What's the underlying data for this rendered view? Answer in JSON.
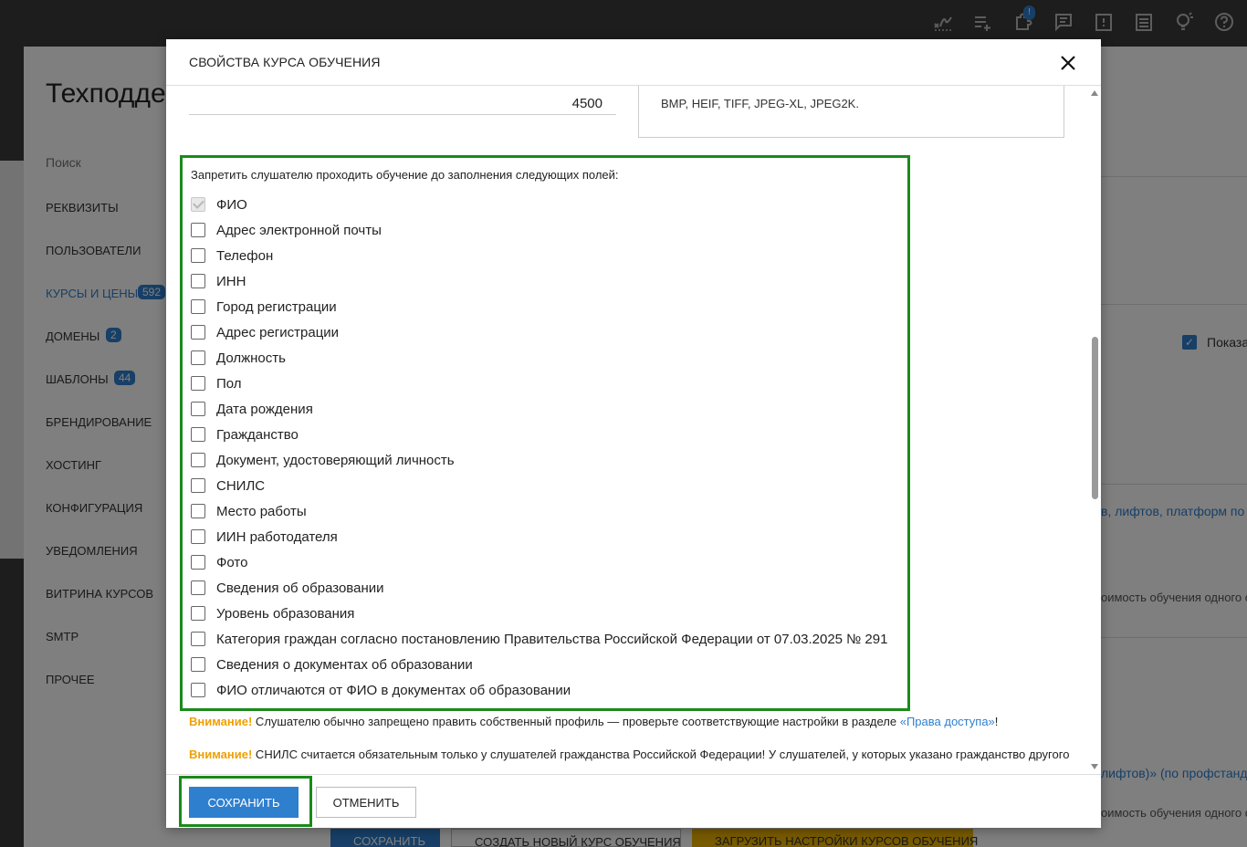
{
  "background": {
    "page_title": "Техподде",
    "search_placeholder": "Поиск",
    "nav": [
      {
        "label": "Реквизиты"
      },
      {
        "label": "Пользователи"
      },
      {
        "label": "Курсы и цены",
        "badge": "592"
      },
      {
        "label": "Домены",
        "badge": "2"
      },
      {
        "label": "Шаблоны",
        "badge": "44"
      },
      {
        "label": "Брендирование"
      },
      {
        "label": "Хостинг"
      },
      {
        "label": "Конфигурация"
      },
      {
        "label": "Уведомления"
      },
      {
        "label": "Витрина курсов"
      },
      {
        "label": "SMTP"
      },
      {
        "label": "Прочее"
      }
    ],
    "right_checkbox_label": "Показа",
    "right_link_1": "в, лифтов, платформ по",
    "right_gray_1": "оимость обучения одного с",
    "right_link_2": "лифтов)» (по профстанд",
    "right_gray_2": "оимость обучения одного с",
    "bottom_buttons": [
      "Сохранить",
      "Создать новый курс обучения",
      "Загрузить настройки курсов обучения"
    ],
    "notification_badge": "!"
  },
  "modal": {
    "title": "Свойства курса обучения",
    "price_value": "4500",
    "info_text": "BMP, HEIF, TIFF, JPEG-XL, JPEG2K.",
    "restrict_title": "Запретить слушателю проходить обучение до заполнения следующих полей:",
    "fields": [
      "ФИО",
      "Адрес электронной почты",
      "Телефон",
      "ИНН",
      "Город регистрации",
      "Адрес регистрации",
      "Должность",
      "Пол",
      "Дата рождения",
      "Гражданство",
      "Документ, удостоверяющий личность",
      "СНИЛС",
      "Место работы",
      "ИИН работодателя",
      "Фото",
      "Сведения об образовании",
      "Уровень образования",
      "Категория граждан согласно постановлению Правительства Российской Федерации от 07.03.2025 № 291",
      "Сведения о документах об образовании",
      "ФИО отличаются от ФИО в документах об образовании"
    ],
    "warning_1": {
      "prefix": "Внимание!",
      "text": " Слушателю обычно запрещено править собственный профиль — проверьте соответствующие настройки в разделе ",
      "link": "«Права доступа»",
      "suffix": "!"
    },
    "warning_2": {
      "prefix": "Внимание!",
      "text": " СНИЛС считается обязательным только у слушателей гражданства Российской Федерации! У слушателей, у которых указано гражданство другого"
    },
    "save_label": "Сохранить",
    "cancel_label": "Отменить"
  },
  "colors": {
    "accent": "#2f7fcf",
    "highlight": "#1a8a1a",
    "warning": "#f0a000"
  }
}
